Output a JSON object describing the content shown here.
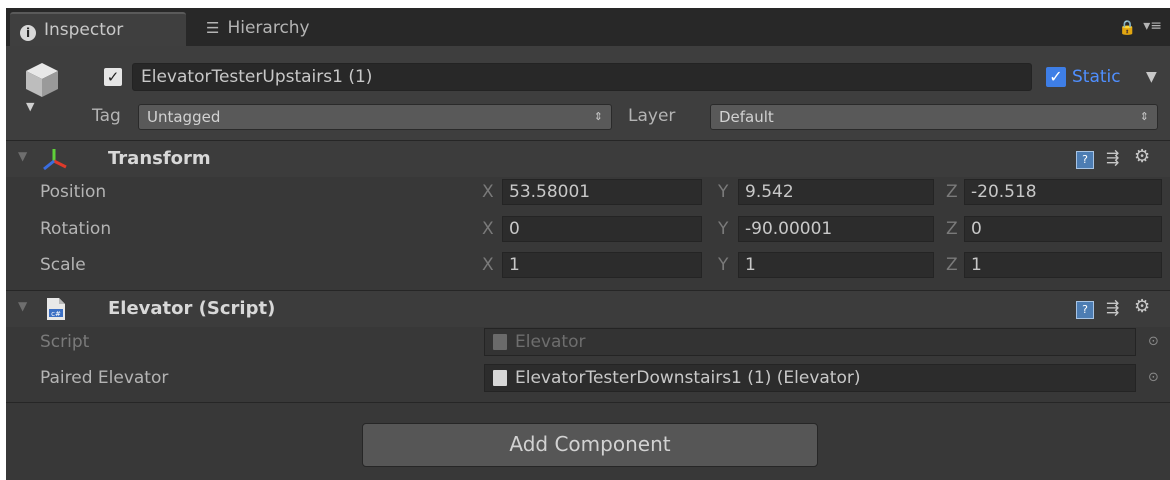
{
  "tabs": {
    "inspector": "Inspector",
    "hierarchy": "Hierarchy"
  },
  "header": {
    "active": true,
    "name": "ElevatorTesterUpstairs1 (1)",
    "static_checked": true,
    "static_label": "Static",
    "tag_label": "Tag",
    "tag_value": "Untagged",
    "layer_label": "Layer",
    "layer_value": "Default"
  },
  "transform": {
    "title": "Transform",
    "rows": [
      {
        "label": "Position",
        "x": "53.58001",
        "y": "9.542",
        "z": "-20.518"
      },
      {
        "label": "Rotation",
        "x": "0",
        "y": "-90.00001",
        "z": "0"
      },
      {
        "label": "Scale",
        "x": "1",
        "y": "1",
        "z": "1"
      }
    ],
    "axis": {
      "x": "X",
      "y": "Y",
      "z": "Z"
    }
  },
  "script_component": {
    "title": "Elevator (Script)",
    "script_label": "Script",
    "script_value": "Elevator",
    "paired_label": "Paired Elevator",
    "paired_value": "ElevatorTesterDownstairs1 (1) (Elevator)"
  },
  "add_component_label": "Add Component",
  "icons": {
    "inspector": "info-icon",
    "hierarchy": "list-icon",
    "lock": "lock-icon",
    "menu": "menu-icon",
    "transform": "transform-axes-icon",
    "script": "csharp-file-icon",
    "help": "help-icon",
    "preset": "preset-icon",
    "gear": "gear-icon"
  },
  "colors": {
    "panel_bg": "#383838",
    "accent_blue": "#3e7ee6",
    "static_text": "#4f8fff"
  }
}
